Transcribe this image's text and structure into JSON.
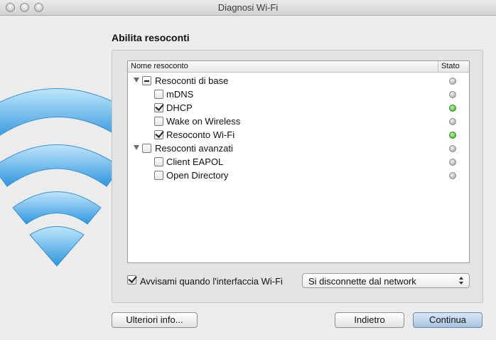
{
  "window": {
    "title": "Diagnosi Wi-Fi"
  },
  "heading": "Abilita resoconti",
  "table": {
    "col_name": "Nome resoconto",
    "col_state": "Stato",
    "rows": [
      {
        "label": "Resoconti di base",
        "check": "mixed",
        "group": true,
        "status": "gray"
      },
      {
        "label": "mDNS",
        "check": "unchecked",
        "group": false,
        "status": "gray"
      },
      {
        "label": "DHCP",
        "check": "checked",
        "group": false,
        "status": "green"
      },
      {
        "label": "Wake on Wireless",
        "check": "unchecked",
        "group": false,
        "status": "gray"
      },
      {
        "label": "Resoconto Wi-Fi",
        "check": "checked",
        "group": false,
        "status": "green"
      },
      {
        "label": "Resoconti avanzati",
        "check": "unchecked",
        "group": true,
        "status": "gray"
      },
      {
        "label": "Client EAPOL",
        "check": "unchecked",
        "group": false,
        "status": "gray"
      },
      {
        "label": "Open Directory",
        "check": "unchecked",
        "group": false,
        "status": "gray"
      }
    ]
  },
  "notify": {
    "label": "Avvisami quando l'interfaccia Wi-Fi",
    "checked": true,
    "select_value": "Si disconnette dal network"
  },
  "buttons": {
    "more_info": "Ulteriori info...",
    "back": "Indietro",
    "continue": "Continua"
  },
  "colors": {
    "status_green": "#2ea81c",
    "status_gray": "#9a9a9a",
    "wifi_blue": "#3aa3e3"
  },
  "icons": {
    "wifi": "wifi-icon",
    "disclosure": "disclosure-triangle-icon"
  }
}
